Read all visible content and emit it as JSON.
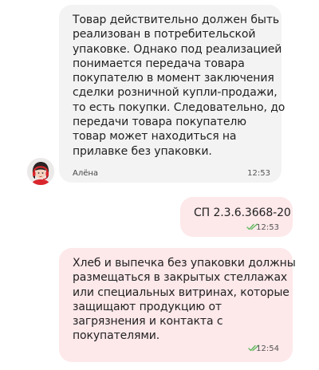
{
  "messages": [
    {
      "text": "Товар действительно должен быть\nреализован в потребительской\nупаковке. Однако под реализацией\nпонимается передача товара\nпокупателю в момент заключения\nсделки розничной купли-продажи,\nто есть покупки. Следовательно, до\nпередачи товара покупателю\nтовар может находиться на\nприлавке без упаковки.",
      "sender": "Алёна",
      "time": "12:53"
    },
    {
      "text": "СП 2.3.6.3668-20",
      "time": "12:53"
    },
    {
      "text": "Хлеб и выпечка без упаковки должны\nразмещаться в закрытых стеллажах\nили специальных витринах, которые\nзащищают продукцию от\nзагрязнения и контакта с\nпокупателями.",
      "time": "12:54"
    }
  ],
  "icons": {
    "avatar": "avatar-girl-with-headset",
    "read_status": "double-check-icon"
  },
  "colors": {
    "incoming_bubble": "#f3f3f3",
    "outgoing_bubble": "#fde8ea",
    "read_check": "#5cb85c",
    "text": "#222222"
  }
}
